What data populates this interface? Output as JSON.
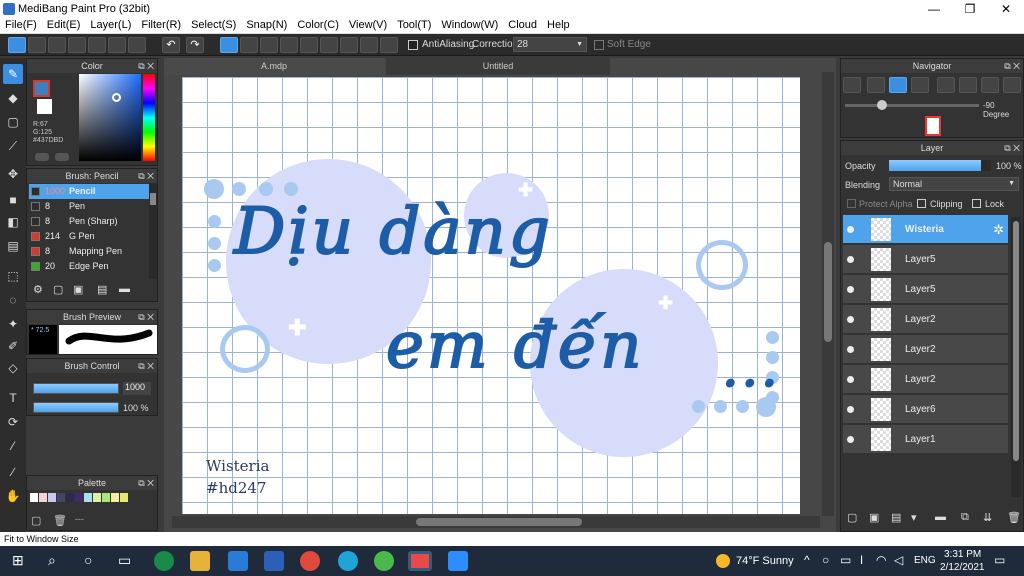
{
  "window": {
    "title": "MediBang Paint Pro (32bit)",
    "minimize": "—",
    "maximize": "❐",
    "close": "✕"
  },
  "menu": [
    "File(F)",
    "Edit(E)",
    "Layer(L)",
    "Filter(R)",
    "Select(S)",
    "Snap(N)",
    "Color(C)",
    "View(V)",
    "Tool(T)",
    "Window(W)",
    "Cloud",
    "Help"
  ],
  "toolbar": {
    "antialiasing_label": "AntiAliasing",
    "correction_label": "Correction",
    "correction_value": "28",
    "soft_edge_label": "Soft Edge"
  },
  "tabs": {
    "tab1": "A.mdp",
    "tab2": "Untitled"
  },
  "color_panel": {
    "title": "Color",
    "r": "R:67",
    "g": "G:125",
    "hex": "#437DBD",
    "primary_color": "#437DBD",
    "secondary_color": "#ffffff"
  },
  "brush_panel": {
    "title": "Brush: Pencil",
    "items": [
      {
        "size": "1000",
        "name": "Pencil",
        "color": "#2d2d2d",
        "selected": true
      },
      {
        "size": "8",
        "name": "Pen",
        "color": "#2d2d2d"
      },
      {
        "size": "8",
        "name": "Pen (Sharp)",
        "color": "#2d2d2d"
      },
      {
        "size": "214",
        "name": "G Pen",
        "color": "#d43a2a"
      },
      {
        "size": "8",
        "name": "Mapping Pen",
        "color": "#d43a2a"
      },
      {
        "size": "20",
        "name": "Edge Pen",
        "color": "#3aaa2a"
      }
    ]
  },
  "brush_preview": {
    "title": "Brush Preview",
    "value": "* 72.5"
  },
  "brush_control": {
    "title": "Brush Control",
    "size": "1000",
    "opacity": "100 %"
  },
  "palette": {
    "title": "Palette",
    "extra": "---",
    "colors": [
      "#ffffff",
      "#f3d3d3",
      "#c8c8f0",
      "#444466",
      "#2a2a4a",
      "#3f2a6a",
      "#a8e0f0",
      "#d8f0a8",
      "#a8e878",
      "#f0f0a0",
      "#e8e878"
    ]
  },
  "canvas": {
    "line1": "Dịu dàng",
    "line2": "em đến",
    "dots": "...",
    "sig1": "Wisteria",
    "sig2": "#hd247"
  },
  "navigator": {
    "title": "Navigator",
    "rotation": "-90 Degree"
  },
  "layer_panel": {
    "title": "Layer",
    "opacity_label": "Opacity",
    "opacity_value": "100 %",
    "opacity_fraction": 0.9,
    "blending_label": "Blending",
    "blending_value": "Normal",
    "protect_alpha": "Protect Alpha",
    "clipping": "Clipping",
    "lock": "Lock",
    "layers": [
      "Wisteria",
      "Layer5",
      "Layer5",
      "Layer2",
      "Layer2",
      "Layer2",
      "Layer6",
      "Layer1"
    ]
  },
  "status": {
    "text": "Fit to Window Size"
  },
  "taskbar": {
    "weather": "74°F  Sunny",
    "lang": "ENG",
    "time": "3:31 PM",
    "date": "2/12/2021"
  }
}
